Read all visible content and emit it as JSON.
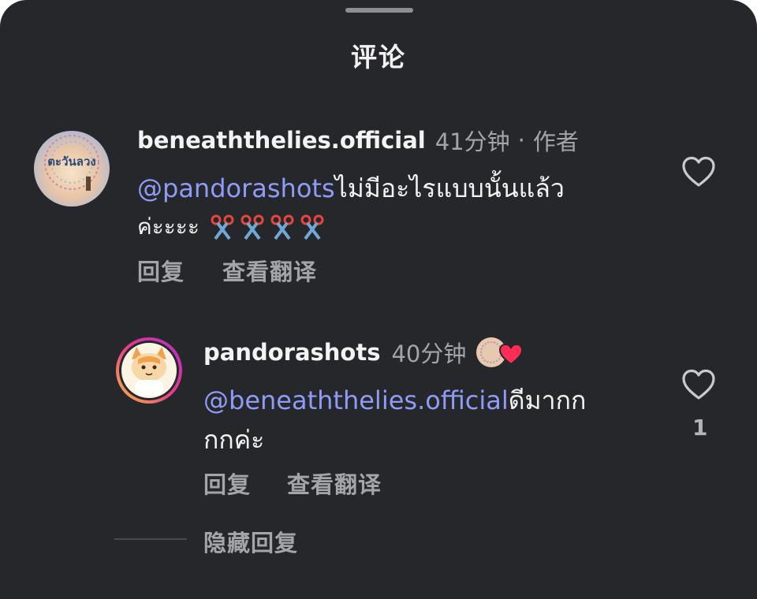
{
  "header": {
    "title": "评论"
  },
  "comments": [
    {
      "username": "beneaththelies.official",
      "time": "41分钟",
      "separator": "·",
      "badge": "作者",
      "avatar_text": "ตะวันลวง",
      "mention": "@pandorashots",
      "text_line1": " ไม่มีอะไรแบบนั้นแล้ว",
      "text_line2": "ค่ะะะะ",
      "emoji": [
        "scissors-icon",
        "scissors-icon",
        "scissors-icon",
        "scissors-icon"
      ],
      "reply_label": "回复",
      "translate_label": "查看翻译"
    }
  ],
  "replies": [
    {
      "username": "pandorashots",
      "time": "40分钟",
      "mention": "@beneaththelies.official",
      "text_line1": " ดีมากก",
      "text_line2": "กกค่ะ",
      "like_count": "1",
      "reply_label": "回复",
      "translate_label": "查看翻译"
    }
  ],
  "thread": {
    "hide_replies_label": "隐藏回复"
  },
  "colors": {
    "background": "#26272b",
    "mention": "#8f9cf6",
    "muted": "#a4a5aa",
    "text": "#f2f2f2",
    "heart_red": "#ff2d55"
  }
}
